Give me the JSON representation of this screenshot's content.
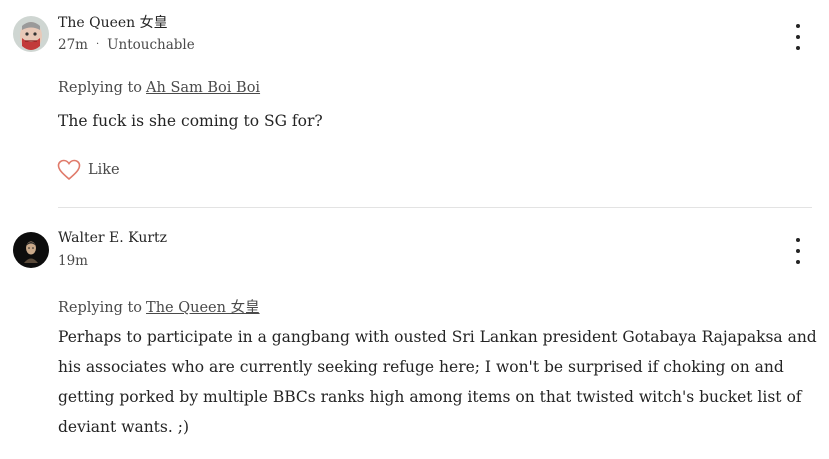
{
  "comments": [
    {
      "author": "The Queen 女皇",
      "time": "27m",
      "separator": "·",
      "tag": "Untouchable",
      "replying_label": "Replying to",
      "replying_to": "Ah Sam Boi Boi",
      "text": "The fuck is she coming to SG for?",
      "like_label": "Like",
      "avatar_icon": "masked-face-avatar",
      "like_icon": "heart-outline-icon",
      "like_color": "#e07a6a"
    },
    {
      "author": "Walter E. Kurtz",
      "time": "19m",
      "replying_label": "Replying to",
      "replying_to": "The Queen 女皇",
      "text": "Perhaps to participate in a gangbang with ousted Sri Lankan president Gotabaya Rajapaksa and his associates who are currently seeking refuge here; I won't be surprised if choking on and getting porked by multiple BBCs ranks high among items on that twisted witch's bucket list of deviant wants. ;)",
      "avatar_icon": "dark-portrait-avatar"
    }
  ]
}
